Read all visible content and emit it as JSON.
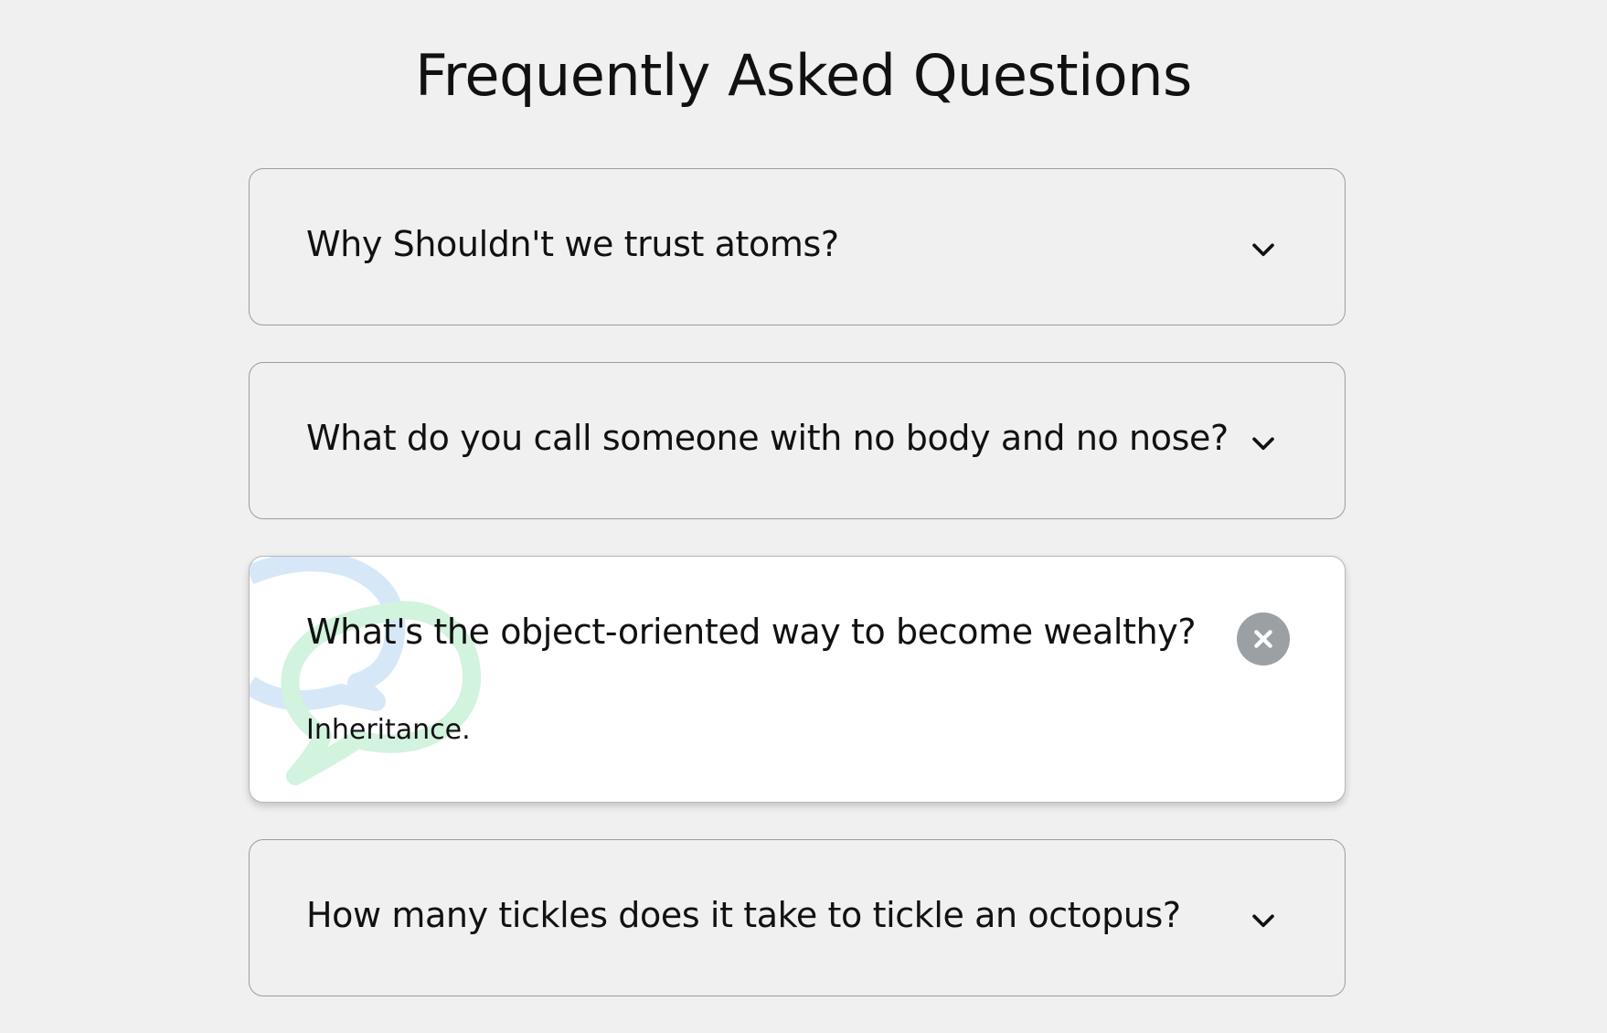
{
  "page": {
    "title": "Frequently Asked Questions"
  },
  "faq": {
    "items": [
      {
        "question": "Why Shouldn't we trust atoms?",
        "expanded": false,
        "icon": "chevron-down-icon"
      },
      {
        "question": "What do you call someone with no body and no nose?",
        "expanded": false,
        "icon": "chevron-down-icon"
      },
      {
        "question": "What's the object-oriented way to become wealthy?",
        "answer": "Inheritance.",
        "expanded": true,
        "icon": "close-icon"
      },
      {
        "question": "How many tickles does it take to tickle an octopus?",
        "expanded": false,
        "icon": "chevron-down-icon"
      }
    ]
  },
  "colors": {
    "background": "#f0f0f0",
    "card_open": "#ffffff",
    "close_button": "#9aa0a4",
    "deco_blue": "#d6e8f7",
    "deco_green": "#d2f3dd"
  }
}
